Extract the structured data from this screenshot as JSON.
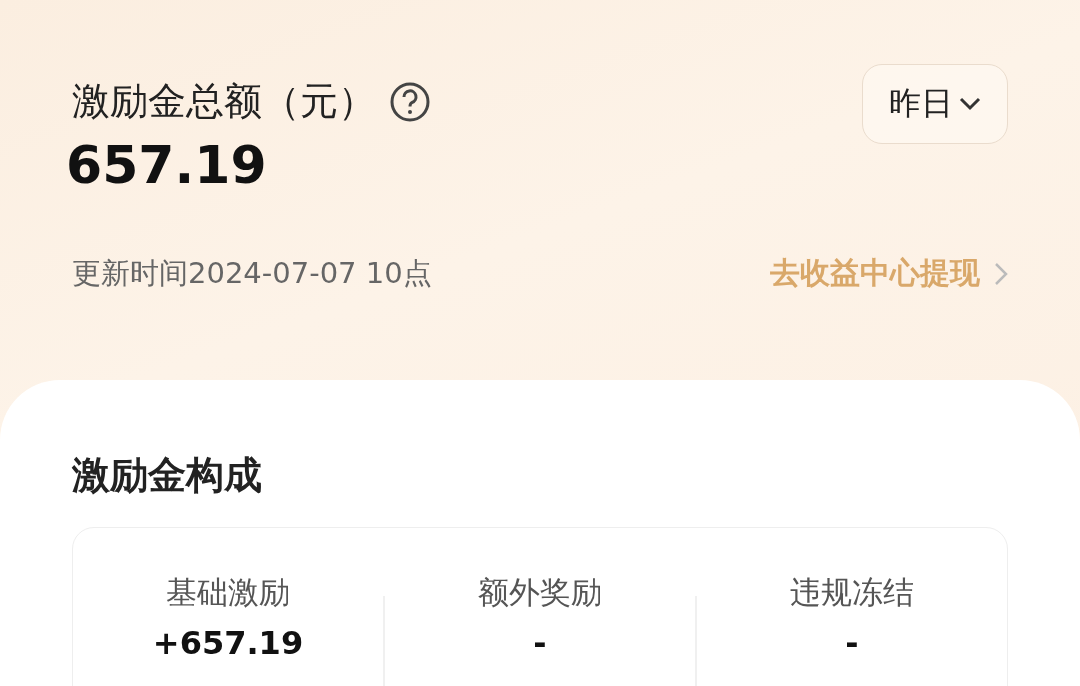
{
  "header": {
    "title": "激励金总额（元）",
    "amount": "657.19",
    "period_button": "昨日",
    "update_time": "更新时间2024-07-07 10点",
    "withdraw_link": "去收益中心提现"
  },
  "breakdown": {
    "title": "激励金构成",
    "items": [
      {
        "label": "基础激励",
        "value": "+657.19"
      },
      {
        "label": "额外奖励",
        "value": "-"
      },
      {
        "label": "违规冻结",
        "value": "-"
      }
    ]
  }
}
